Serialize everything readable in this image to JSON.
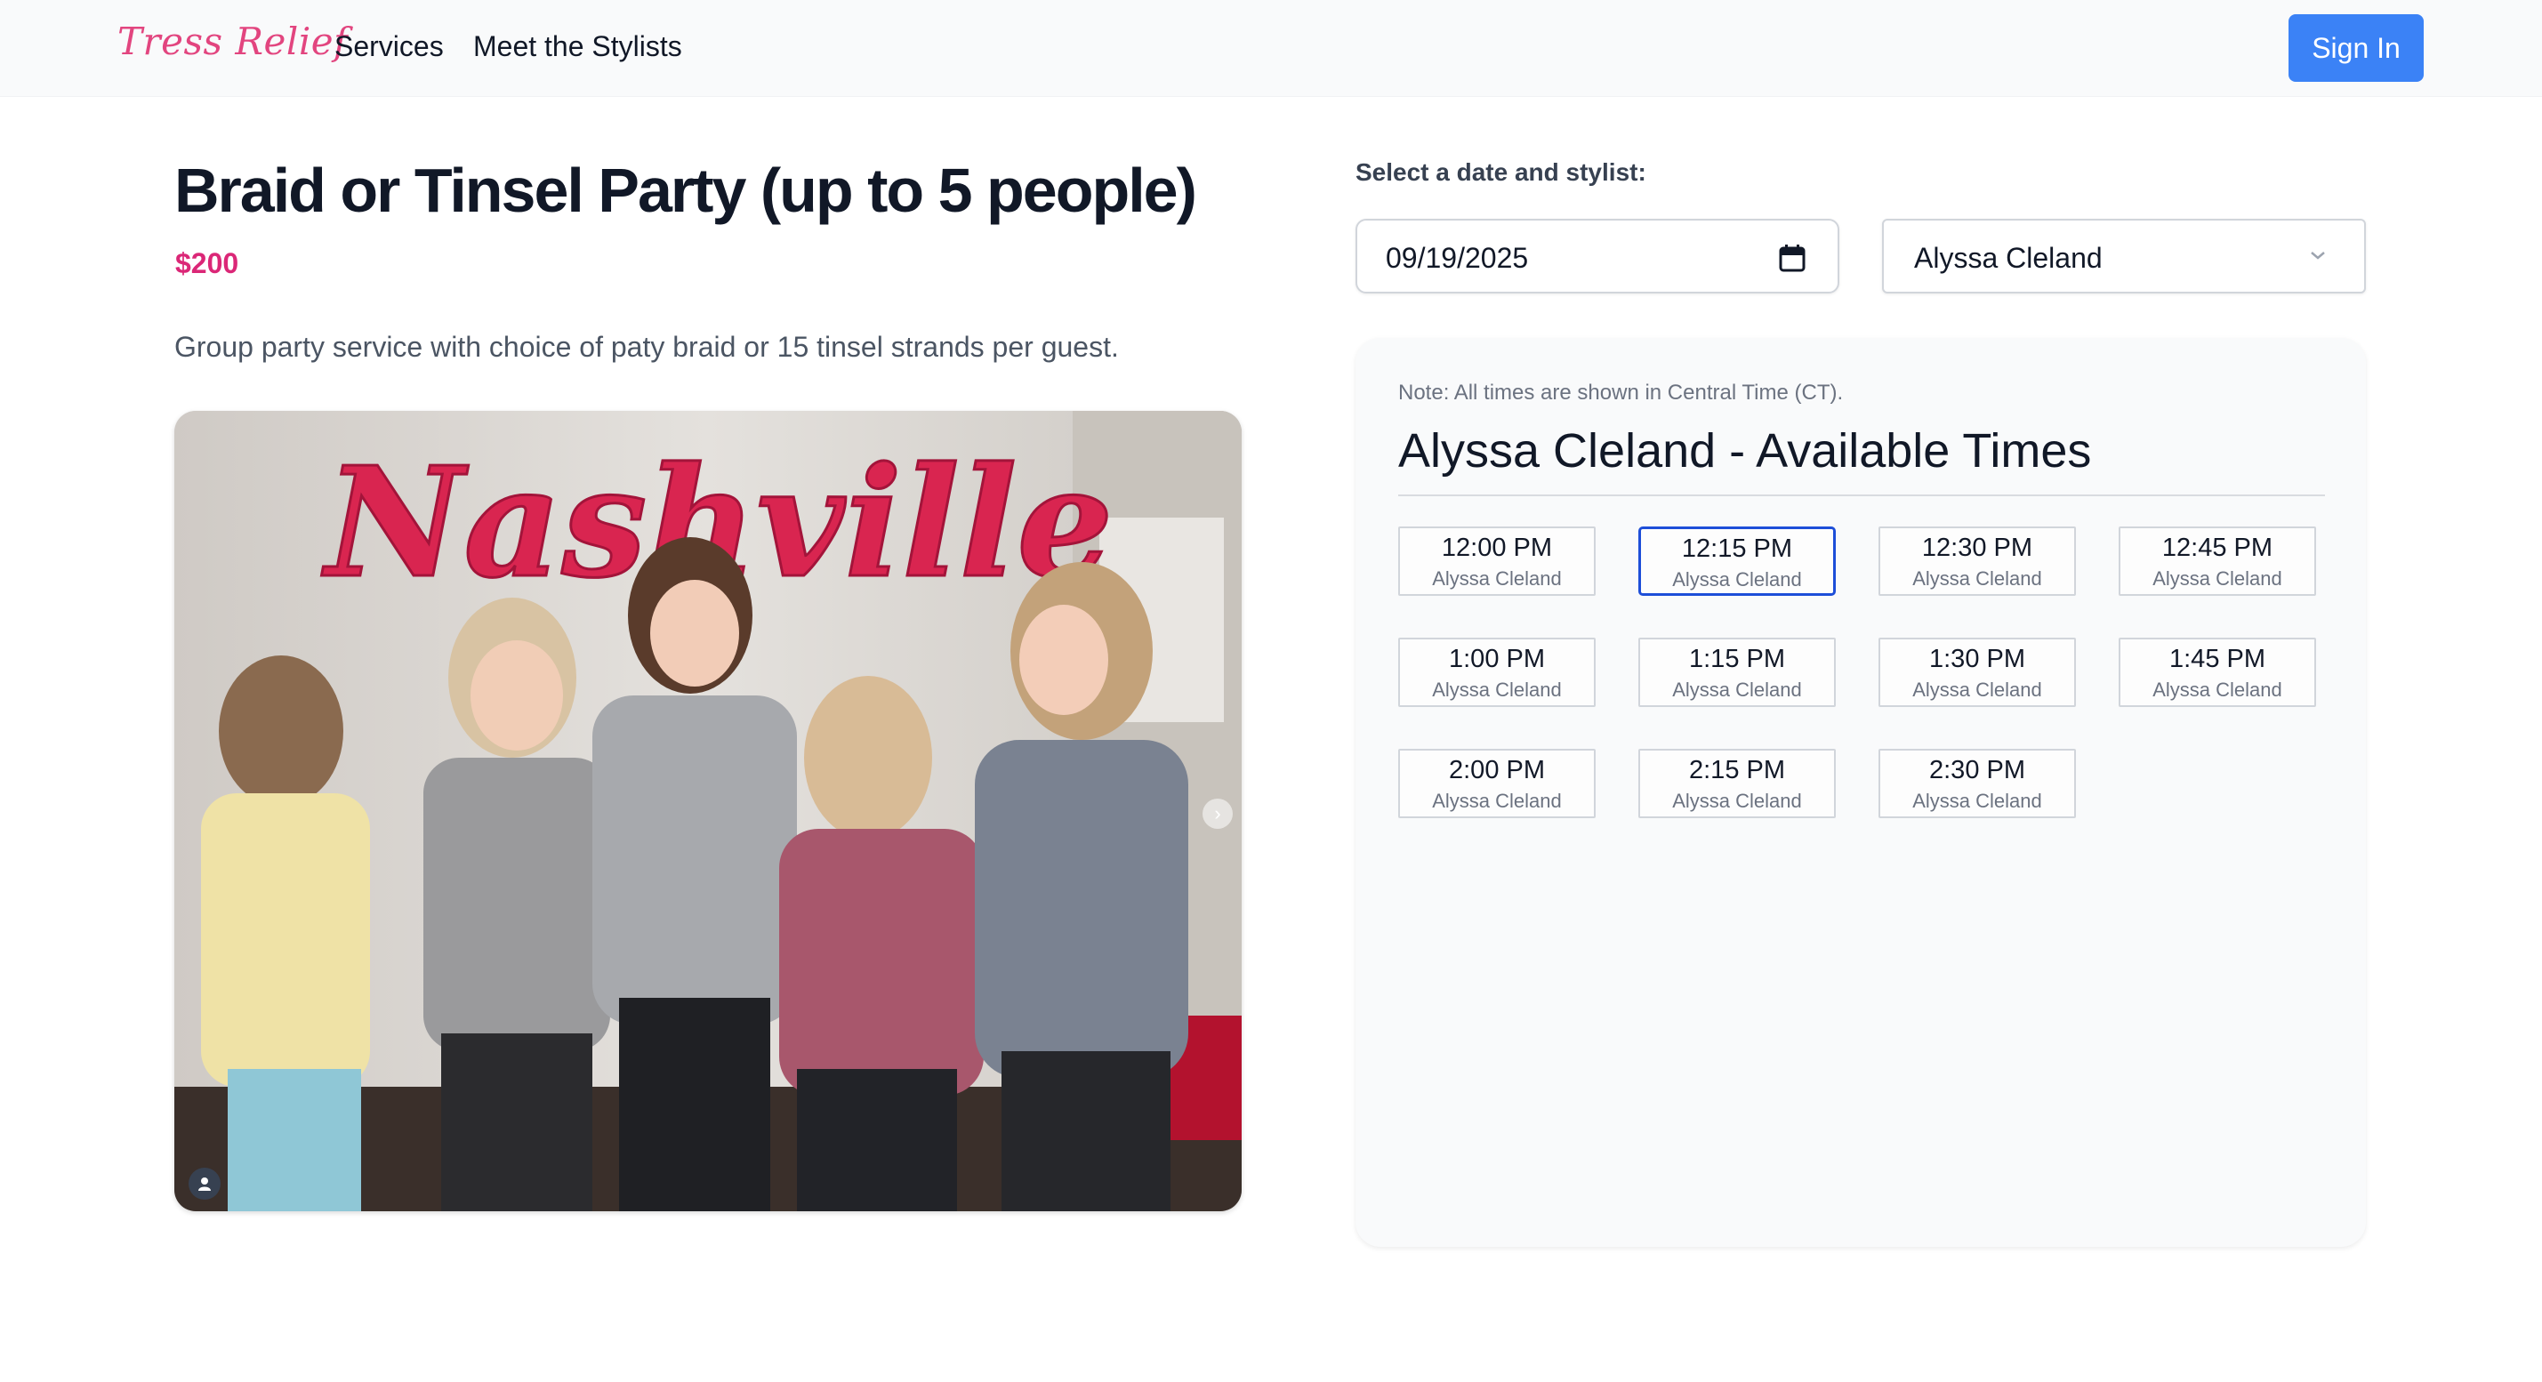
{
  "nav": {
    "brand": "Tress Relief",
    "links": [
      "Services",
      "Meet the Stylists"
    ],
    "sign_in": "Sign In"
  },
  "service": {
    "title": "Braid or Tinsel Party (up to 5 people)",
    "price": "$200",
    "description": "Group party service with choice of paty braid or 15 tinsel strands per guest.",
    "photo_sign_text": "Nashville"
  },
  "booking": {
    "label": "Select a date and stylist:",
    "date": "09/19/2025",
    "stylist": "Alyssa Cleland",
    "note": "Note: All times are shown in Central Time (CT).",
    "heading": "Alyssa Cleland - Available Times",
    "selected_index": 1,
    "slots": [
      {
        "time": "12:00 PM",
        "stylist": "Alyssa Cleland"
      },
      {
        "time": "12:15 PM",
        "stylist": "Alyssa Cleland"
      },
      {
        "time": "12:30 PM",
        "stylist": "Alyssa Cleland"
      },
      {
        "time": "12:45 PM",
        "stylist": "Alyssa Cleland"
      },
      {
        "time": "1:00 PM",
        "stylist": "Alyssa Cleland"
      },
      {
        "time": "1:15 PM",
        "stylist": "Alyssa Cleland"
      },
      {
        "time": "1:30 PM",
        "stylist": "Alyssa Cleland"
      },
      {
        "time": "1:45 PM",
        "stylist": "Alyssa Cleland"
      },
      {
        "time": "2:00 PM",
        "stylist": "Alyssa Cleland"
      },
      {
        "time": "2:15 PM",
        "stylist": "Alyssa Cleland"
      },
      {
        "time": "2:30 PM",
        "stylist": "Alyssa Cleland"
      }
    ]
  },
  "colors": {
    "brand": "#e2457f",
    "accent": "#3b82f6",
    "price": "#db2777",
    "selected_border": "#1d4ed8"
  }
}
